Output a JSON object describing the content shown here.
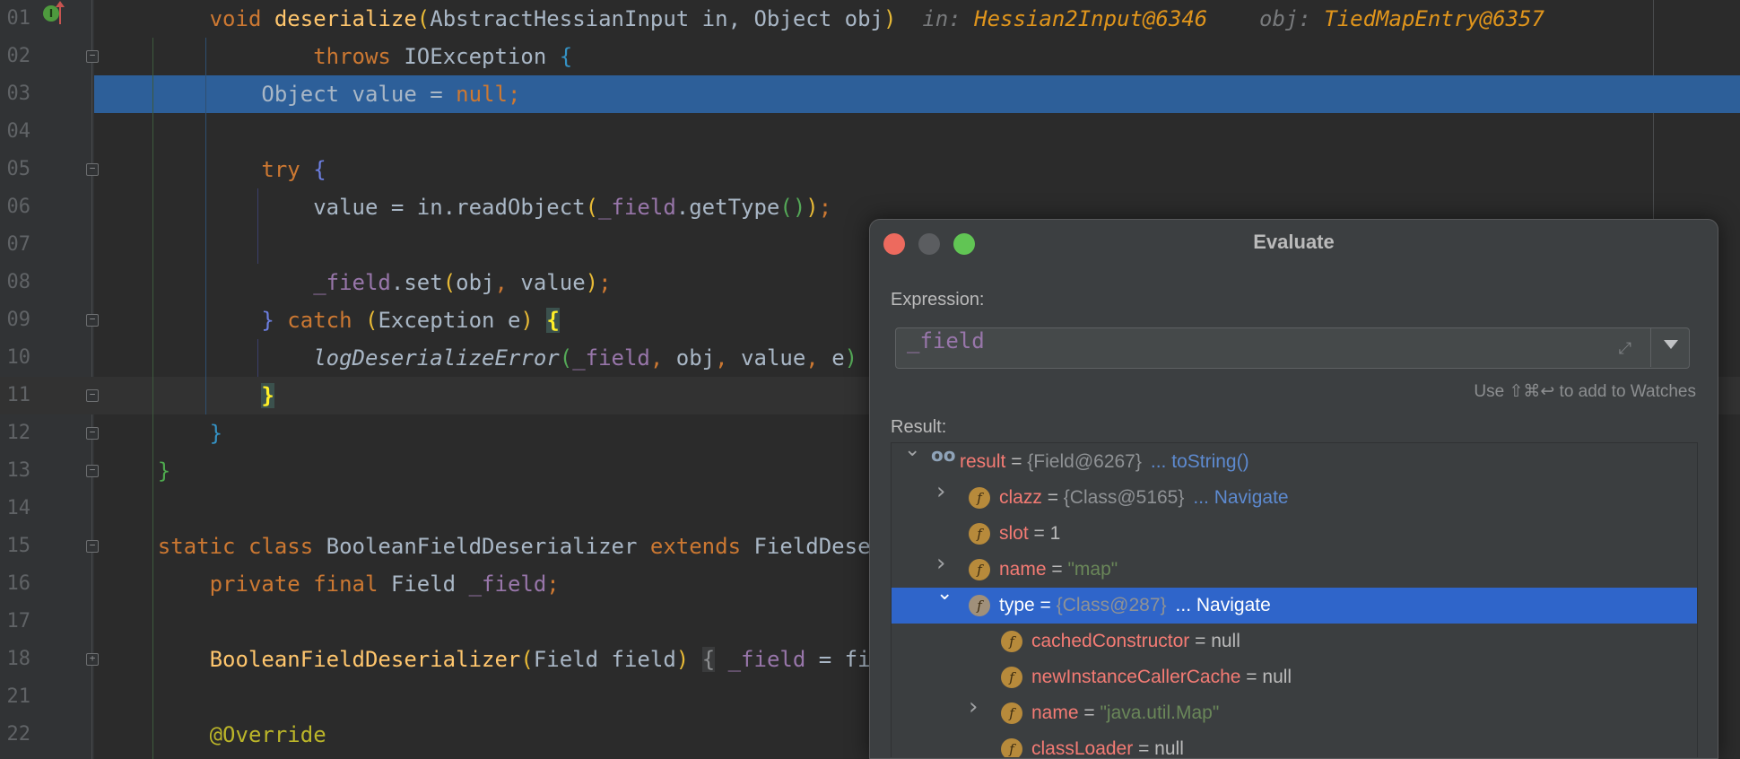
{
  "editor": {
    "line_numbers": [
      "01",
      "02",
      "03",
      "04",
      "05",
      "06",
      "07",
      "08",
      "09",
      "10",
      "11",
      "12",
      "13",
      "14",
      "15",
      "16",
      "17",
      "18",
      "21",
      "22"
    ],
    "highlighted_line": 3,
    "current_line": 11,
    "lines": [
      [
        [
          "        ",
          "tx"
        ],
        [
          "void",
          "kw"
        ],
        [
          " ",
          "tx"
        ],
        [
          "deserialize",
          "decl"
        ],
        [
          "(",
          "py"
        ],
        [
          "AbstractHessianInput in, Object obj",
          "tx"
        ],
        [
          ")",
          "py"
        ],
        [
          "  in: ",
          "hint"
        ],
        [
          "Hessian2Input@6346",
          "hv"
        ],
        [
          "    obj: ",
          "hint"
        ],
        [
          "TiedMapEntry@6357",
          "hv"
        ]
      ],
      [
        [
          "                ",
          "tx"
        ],
        [
          "throws",
          "kw"
        ],
        [
          " IOException ",
          "tx"
        ],
        [
          "{",
          "bb"
        ]
      ],
      [
        [
          "            Object value = ",
          "tx"
        ],
        [
          "null;",
          "kw"
        ]
      ],
      [],
      [
        [
          "            ",
          "tx"
        ],
        [
          "try",
          "kw"
        ],
        [
          " ",
          "tx"
        ],
        [
          "{",
          "bp"
        ]
      ],
      [
        [
          "                value = in.readObject",
          "tx"
        ],
        [
          "(",
          "py"
        ],
        [
          "_field",
          "fld"
        ],
        [
          ".getType",
          "tx"
        ],
        [
          "()",
          "pg"
        ],
        [
          ")",
          "py"
        ],
        [
          ";",
          "kw"
        ]
      ],
      [],
      [
        [
          "                ",
          "tx"
        ],
        [
          "_field",
          "fld"
        ],
        [
          ".set",
          "tx"
        ],
        [
          "(",
          "py"
        ],
        [
          "obj",
          "tx"
        ],
        [
          ",",
          "kw"
        ],
        [
          " value",
          "tx"
        ],
        [
          ")",
          "py"
        ],
        [
          ";",
          "kw"
        ]
      ],
      [
        [
          "            ",
          "tx"
        ],
        [
          "}",
          "bp"
        ],
        [
          " ",
          "tx"
        ],
        [
          "catch",
          "kw"
        ],
        [
          " ",
          "tx"
        ],
        [
          "(",
          "py"
        ],
        [
          "Exception e",
          "tx"
        ],
        [
          ")",
          "py"
        ],
        [
          " ",
          "tx"
        ],
        [
          "{",
          "mb"
        ]
      ],
      [
        [
          "                ",
          "tx"
        ],
        [
          "logDeserializeError",
          "tx it"
        ],
        [
          "(",
          "pg"
        ],
        [
          "_field",
          "fld"
        ],
        [
          ",",
          "kw"
        ],
        [
          " obj",
          "tx"
        ],
        [
          ",",
          "kw"
        ],
        [
          " value",
          "tx"
        ],
        [
          ",",
          "kw"
        ],
        [
          " e",
          "tx"
        ],
        [
          ")",
          "pg"
        ]
      ],
      [
        [
          "            ",
          "tx"
        ],
        [
          "}",
          "mb"
        ]
      ],
      [
        [
          "        ",
          "tx"
        ],
        [
          "}",
          "bb"
        ]
      ],
      [
        [
          "    ",
          "tx"
        ],
        [
          "}",
          "bgreen"
        ]
      ],
      [],
      [
        [
          "    ",
          "tx"
        ],
        [
          "static class",
          "kw"
        ],
        [
          " BooleanFieldDeserializer ",
          "tx"
        ],
        [
          "extends",
          "kw"
        ],
        [
          " FieldDeserializer",
          "tx"
        ]
      ],
      [
        [
          "        ",
          "tx"
        ],
        [
          "private final",
          "kw"
        ],
        [
          " Field ",
          "tx"
        ],
        [
          "_field",
          "fld"
        ],
        [
          ";",
          "kw"
        ]
      ],
      [],
      [
        [
          "        ",
          "tx"
        ],
        [
          "BooleanFieldDeserializer",
          "decl"
        ],
        [
          "(",
          "py"
        ],
        [
          "Field field",
          "tx"
        ],
        [
          ")",
          "py"
        ],
        [
          " ",
          "tx"
        ],
        [
          "{",
          "gb"
        ],
        [
          " ",
          "tx"
        ],
        [
          "_field",
          "fld"
        ],
        [
          " = field; }",
          "tx"
        ]
      ],
      [],
      [
        [
          "        ",
          "tx"
        ],
        [
          "@Override",
          "ann"
        ]
      ]
    ]
  },
  "dialog": {
    "title": "Evaluate",
    "expression_label": "Expression:",
    "expression_value": "_field",
    "watches_hint": "Use ⇧⌘↩ to add to Watches",
    "result_label": "Result:",
    "colors": {
      "close": "#ed6a5e",
      "minimize": "#5b5d60",
      "zoom": "#61c554",
      "selection": "#2f65ca"
    },
    "tree": [
      {
        "depth": 0,
        "chevron": "expanded",
        "icon": "watch-glasses",
        "name": "result",
        "eq": " = ",
        "value": "{Field@6267}",
        "value_type": "ref",
        "link": "... toString()"
      },
      {
        "depth": 1,
        "chevron": "collapsed",
        "icon": "field",
        "name": "clazz",
        "eq": " = ",
        "value": "{Class@5165}",
        "value_type": "ref",
        "link": "... Navigate"
      },
      {
        "depth": 1,
        "chevron": "none",
        "icon": "field",
        "name": "slot",
        "eq": " = ",
        "value": "1",
        "value_type": "plain",
        "link": ""
      },
      {
        "depth": 1,
        "chevron": "collapsed",
        "icon": "field",
        "name": "name",
        "eq": " = ",
        "value": "\"map\"",
        "value_type": "str",
        "link": ""
      },
      {
        "depth": 1,
        "chevron": "expanded",
        "icon": "field",
        "name": "type",
        "eq": " = ",
        "value": "{Class@287}",
        "value_type": "ref",
        "link": "... Navigate",
        "selected": true
      },
      {
        "depth": 2,
        "chevron": "none",
        "icon": "field",
        "name": "cachedConstructor",
        "eq": " = ",
        "value": "null",
        "value_type": "plain",
        "link": ""
      },
      {
        "depth": 2,
        "chevron": "none",
        "icon": "field",
        "name": "newInstanceCallerCache",
        "eq": " = ",
        "value": "null",
        "value_type": "plain",
        "link": ""
      },
      {
        "depth": 2,
        "chevron": "collapsed",
        "icon": "field",
        "name": "name",
        "eq": " = ",
        "value": "\"java.util.Map\"",
        "value_type": "str",
        "link": ""
      },
      {
        "depth": 2,
        "chevron": "none",
        "icon": "field",
        "name": "classLoader",
        "eq": " = ",
        "value": "null",
        "value_type": "plain",
        "link": ""
      }
    ]
  }
}
